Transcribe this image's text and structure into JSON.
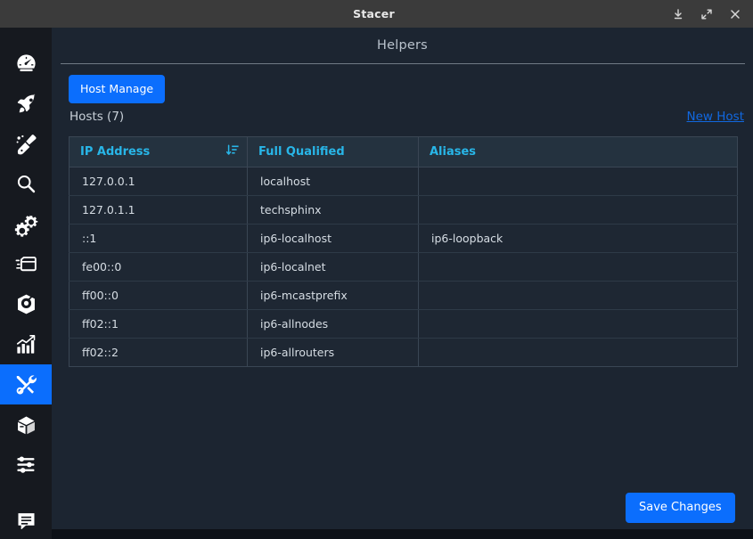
{
  "window": {
    "title": "Stacer",
    "controls": [
      {
        "name": "minimize-button",
        "icon": "minimize-icon",
        "label": "Minimize"
      },
      {
        "name": "maximize-button",
        "icon": "maximize-icon",
        "label": "Maximize"
      },
      {
        "name": "close-button",
        "icon": "close-icon",
        "label": "Close"
      }
    ]
  },
  "sidebar": {
    "items": [
      {
        "icon": "dashboard-gauge-icon",
        "label": "Dashboard",
        "active": false
      },
      {
        "icon": "rocket-icon",
        "label": "Startup Apps",
        "active": false
      },
      {
        "icon": "broom-icon",
        "label": "System Cleaner",
        "active": false
      },
      {
        "icon": "magnifier-icon",
        "label": "Search",
        "active": false
      },
      {
        "icon": "gears-icon",
        "label": "Services",
        "active": false
      },
      {
        "icon": "processes-icon",
        "label": "Processes",
        "active": false
      },
      {
        "icon": "uninstaller-icon",
        "label": "Uninstaller",
        "active": false
      },
      {
        "icon": "chart-bars-icon",
        "label": "Resources",
        "active": false
      },
      {
        "icon": "tools-icon",
        "label": "Helpers",
        "active": true
      },
      {
        "icon": "package-box-icon",
        "label": "Packages",
        "active": false
      },
      {
        "icon": "sliders-icon",
        "label": "Settings",
        "active": false
      },
      {
        "icon": "feedback-icon",
        "label": "Feedback",
        "active": false
      }
    ]
  },
  "main": {
    "page_title": "Helpers",
    "host_manage_label": "Host Manage",
    "hosts_label": "Hosts (7)",
    "hosts_count": 7,
    "new_host_label": "New Host",
    "save_changes_label": "Save Changes",
    "table": {
      "sort_icon": "sort-descending-icon",
      "sorted_column": "IP Address",
      "columns": [
        "IP Address",
        "Full Qualified",
        "Aliases"
      ],
      "rows": [
        {
          "ip": "127.0.0.1",
          "fqdn": "localhost",
          "aliases": ""
        },
        {
          "ip": "127.0.1.1",
          "fqdn": "techsphinx",
          "aliases": ""
        },
        {
          "ip": "::1",
          "fqdn": "ip6-localhost",
          "aliases": "ip6-loopback"
        },
        {
          "ip": "fe00::0",
          "fqdn": "ip6-localnet",
          "aliases": ""
        },
        {
          "ip": "ff00::0",
          "fqdn": "ip6-mcastprefix",
          "aliases": ""
        },
        {
          "ip": "ff02::1",
          "fqdn": "ip6-allnodes",
          "aliases": ""
        },
        {
          "ip": "ff02::2",
          "fqdn": "ip6-allrouters",
          "aliases": ""
        }
      ]
    }
  },
  "colors": {
    "accent": "#0b6efd",
    "titlebar": "#3b3b3b",
    "sidebar": "#16191f",
    "content_bg": "#1c2531",
    "table_header_bg": "#24323f",
    "table_header_text": "#28b6e8",
    "row_bg": "#1e2733",
    "link": "#1168e0"
  }
}
